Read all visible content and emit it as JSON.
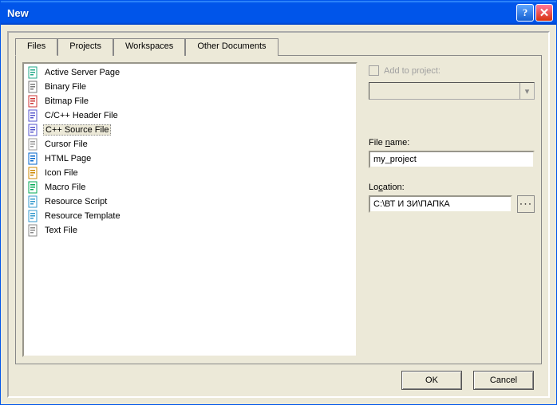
{
  "window": {
    "title": "New"
  },
  "tabs": [
    {
      "label": "Files",
      "active": true
    },
    {
      "label": "Projects",
      "active": false
    },
    {
      "label": "Workspaces",
      "active": false
    },
    {
      "label": "Other Documents",
      "active": false
    }
  ],
  "fileTypes": [
    {
      "label": "Active Server Page",
      "icon": "asp-icon"
    },
    {
      "label": "Binary File",
      "icon": "binary-icon"
    },
    {
      "label": "Bitmap File",
      "icon": "bitmap-icon"
    },
    {
      "label": "C/C++ Header File",
      "icon": "header-icon"
    },
    {
      "label": "C++ Source File",
      "icon": "cpp-icon",
      "selected": true
    },
    {
      "label": "Cursor File",
      "icon": "cursor-icon"
    },
    {
      "label": "HTML Page",
      "icon": "html-icon"
    },
    {
      "label": "Icon File",
      "icon": "icon-file-icon"
    },
    {
      "label": "Macro File",
      "icon": "macro-icon"
    },
    {
      "label": "Resource Script",
      "icon": "resource-script-icon"
    },
    {
      "label": "Resource Template",
      "icon": "resource-template-icon"
    },
    {
      "label": "Text File",
      "icon": "text-icon"
    }
  ],
  "right": {
    "addToProjectLabel": "Add to project:",
    "addToProjectChecked": false,
    "addToProjectEnabled": false,
    "fileNameLabel": "File name:",
    "fileNameValue": "my_project",
    "locationLabel": "Location:",
    "locationValue": "C:\\ВТ И ЗИ\\ПАПКА"
  },
  "buttons": {
    "ok": "OK",
    "cancel": "Cancel"
  }
}
